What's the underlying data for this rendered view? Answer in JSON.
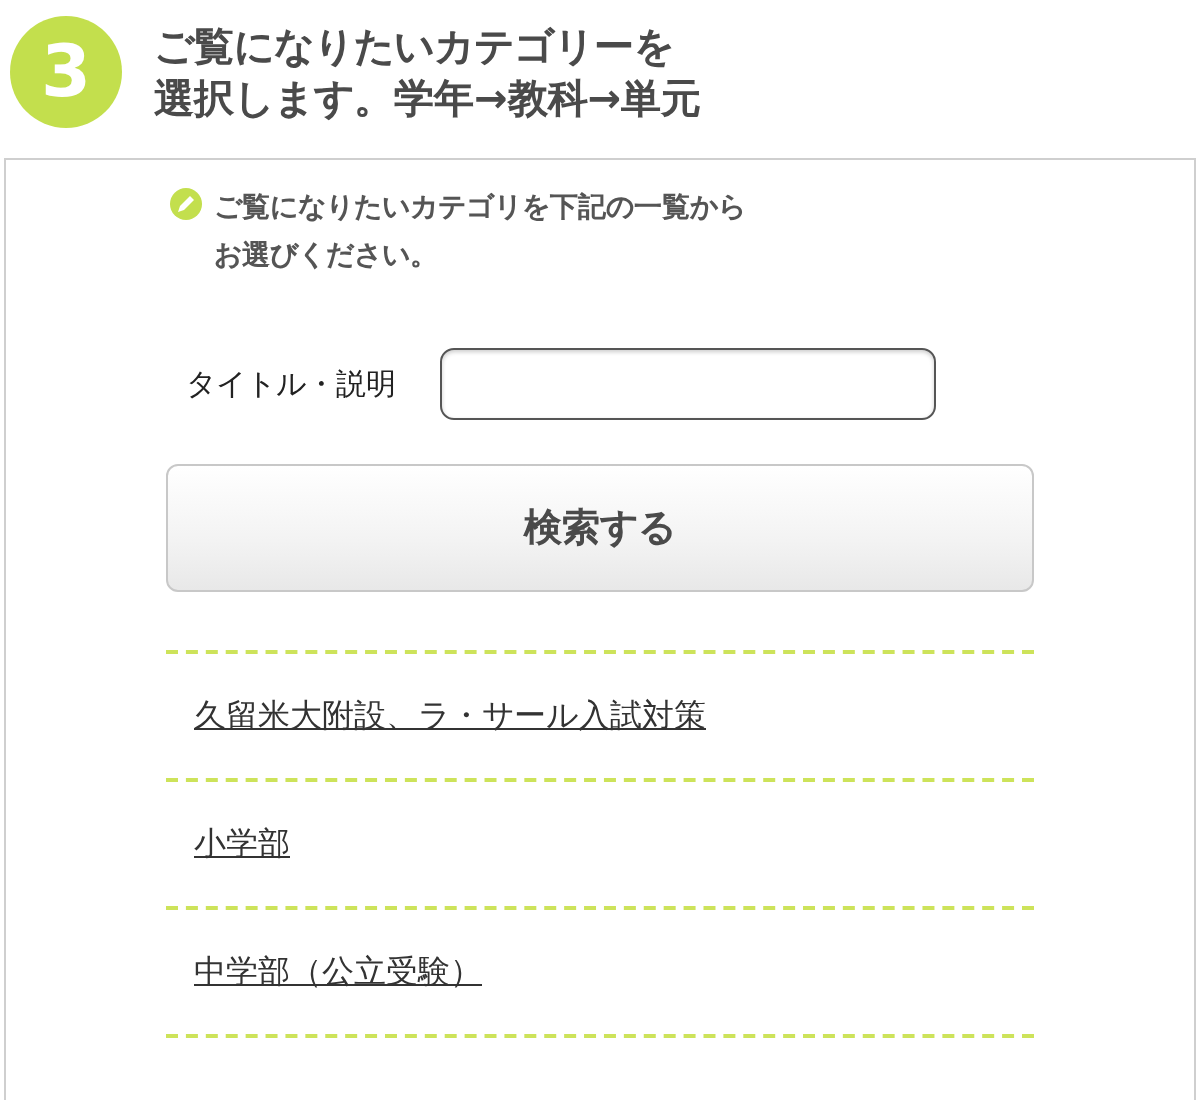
{
  "step": {
    "number": "3",
    "title_lines": [
      "ご覧になりたいカテゴリーを",
      "選択します。学年→教科→単元"
    ]
  },
  "panel": {
    "hint_lines": [
      "ご覧になりたいカテゴリを下記の一覧から",
      "お選びください。"
    ],
    "search_label": "タイトル・説明",
    "search_button": "検索する",
    "links": [
      "久留米大附設、ラ・サール入試対策",
      "小学部",
      "中学部（公立受験）"
    ]
  }
}
